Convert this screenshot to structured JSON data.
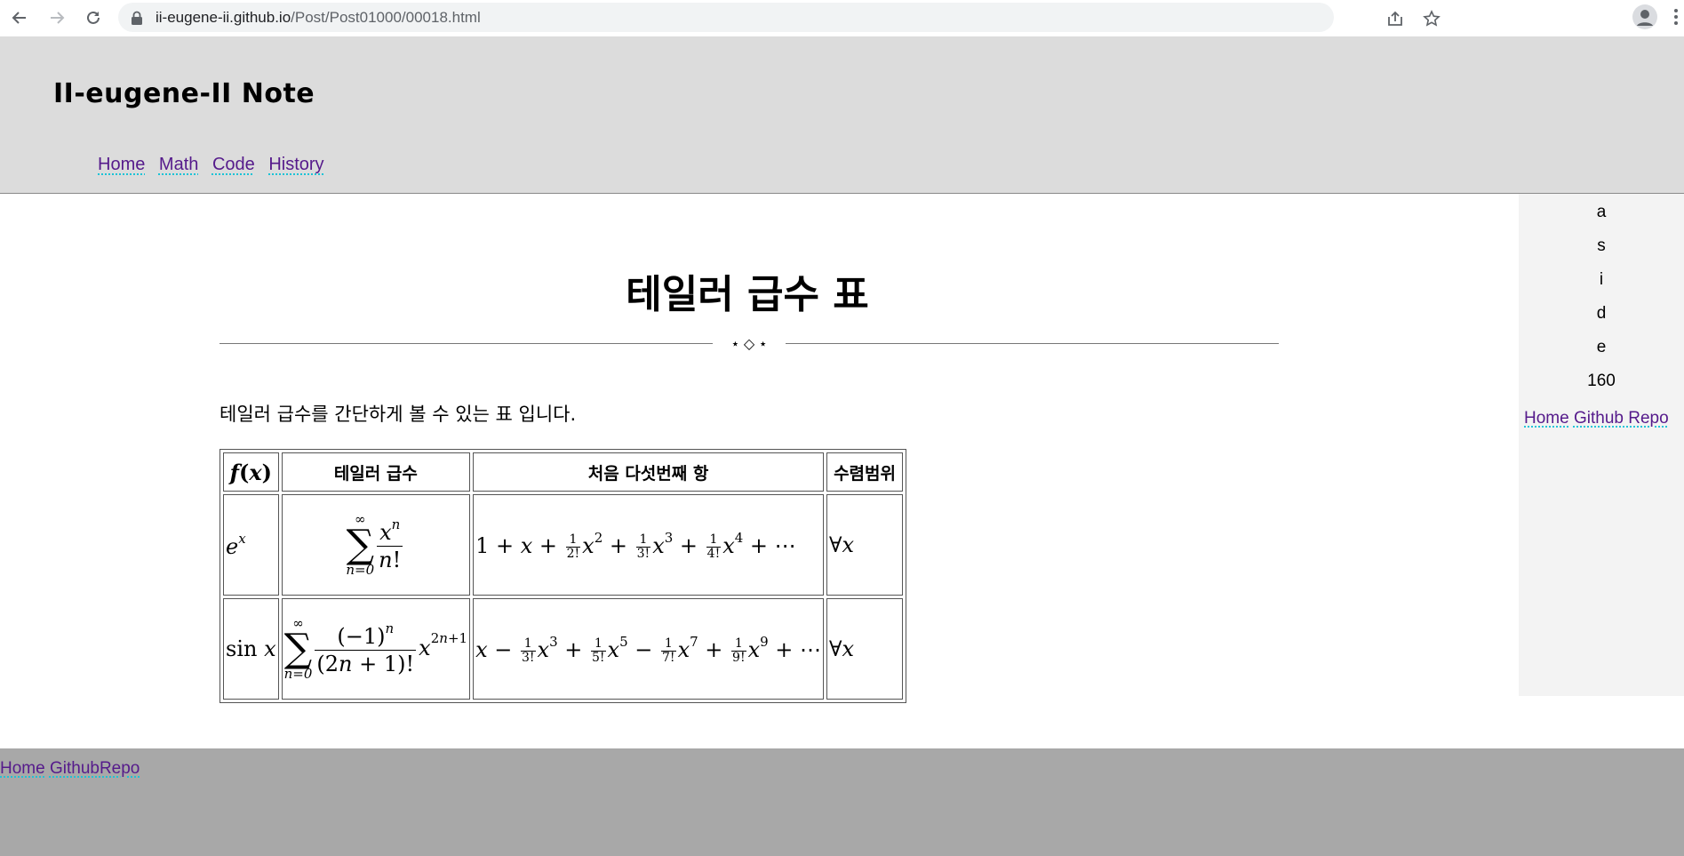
{
  "browser": {
    "url_host": "ii-eugene-ii.github.io",
    "url_path": "/Post/Post01000/00018.html",
    "icons": [
      "back-arrow-icon",
      "forward-arrow-icon",
      "reload-icon",
      "lock-icon",
      "share-icon",
      "star-icon",
      "profile-icon",
      "kebab-menu-icon"
    ]
  },
  "header": {
    "site_title": "II-eugene-II Note",
    "nav": [
      "Home",
      "Math",
      "Code",
      "History"
    ]
  },
  "article": {
    "title": "테일러 급수 표",
    "divider": "⋆ ◇ ⋆",
    "intro": "테일러 급수를 간단하게 볼 수 있는 표 입니다."
  },
  "table": {
    "headers": [
      "f(x)",
      "테일러 급수",
      "처음 다섯번째 항",
      "수렴범위"
    ],
    "rows": [
      {
        "function": "e^x",
        "series": "Σ_{n=0}^{∞} x^n / n!",
        "first_terms": "1 + x + (1/2!)x^2 + (1/3!)x^3 + (1/4!)x^4 + ⋯",
        "convergence": "∀x"
      },
      {
        "function": "sin x",
        "series": "Σ_{n=0}^{∞} (−1)^n / (2n+1)! · x^(2n+1)",
        "first_terms": "x − (1/3!)x^3 + (1/5!)x^5 − (1/7!)x^7 + (1/9!)x^9 + ⋯",
        "convergence": "∀x"
      }
    ]
  },
  "aside": {
    "letters": [
      "a",
      "s",
      "i",
      "d",
      "e",
      "160"
    ],
    "links": [
      "Home",
      "Github Repo"
    ]
  },
  "footer": {
    "links": [
      "Home",
      "GithubRepo"
    ]
  },
  "colors": {
    "header_bg": "#dcdcdc",
    "aside_bg": "#f3f3f3",
    "footer_bg": "#a8a8a8",
    "link": "#551a8b",
    "link_underline": "#19c3d6"
  }
}
